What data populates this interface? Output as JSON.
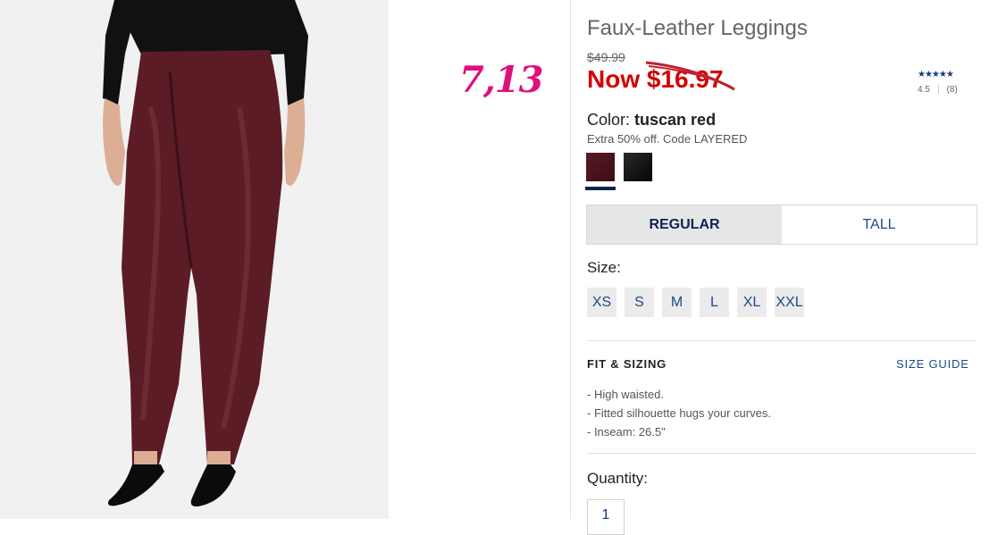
{
  "product": {
    "title": "Faux-Leather Leggings",
    "original_price": "$49.99",
    "now_price": "Now $16.97",
    "color_label": "Color:",
    "color_value": "tuscan red",
    "promo": "Extra 50% off. Code LAYERED",
    "swatches": [
      {
        "name": "tuscan red",
        "color": "#4a1520",
        "selected": true
      },
      {
        "name": "black",
        "color": "#111111",
        "selected": false
      }
    ]
  },
  "annotation": {
    "text": "7,13",
    "color": "#e0107b"
  },
  "rating": {
    "stars": "★★★★★",
    "score": "4.5",
    "count": "(8)",
    "value": 4.5
  },
  "fit_tabs": [
    {
      "label": "REGULAR",
      "active": true
    },
    {
      "label": "TALL",
      "active": false
    }
  ],
  "size": {
    "label": "Size:",
    "options": [
      "XS",
      "S",
      "M",
      "L",
      "XL",
      "XXL"
    ]
  },
  "fit_sizing": {
    "heading": "FIT & SIZING",
    "guide_link": "SIZE GUIDE",
    "bullets": [
      "- High waisted.",
      "- Fitted silhouette hugs your curves.",
      "- Inseam: 26.5\""
    ]
  },
  "quantity": {
    "label": "Quantity:",
    "value": "1"
  },
  "colors": {
    "price_red": "#d40000",
    "link_blue": "#1b4a8a",
    "navy": "#0d2451"
  }
}
